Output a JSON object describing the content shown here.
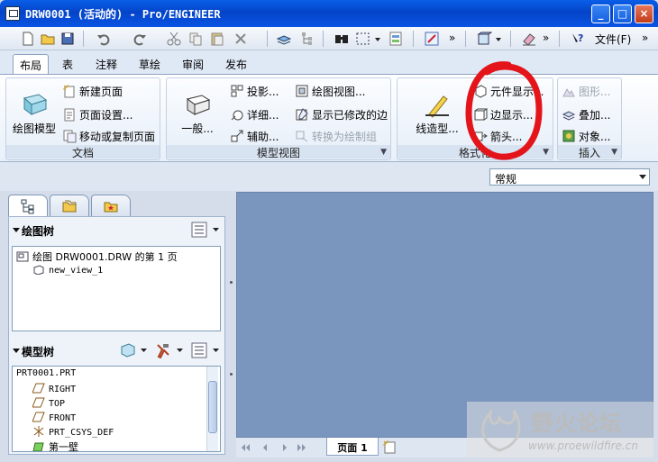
{
  "window": {
    "title": "DRW0001 (活动的) - Pro/ENGINEER",
    "minimize": "_",
    "maximize": "□",
    "close": "×"
  },
  "quickbar": {
    "file_menu": "文件(F)",
    "overflow": "»"
  },
  "tabs": [
    "布局",
    "表",
    "注释",
    "草绘",
    "审阅",
    "发布"
  ],
  "ribbon": {
    "document": {
      "label": "文档",
      "big_button": "绘图模型",
      "new_page": "新建页面",
      "page_setup": "页面设置...",
      "move_copy_page": "移动或复制页面"
    },
    "model_views": {
      "label": "模型视图",
      "big_button": "一般...",
      "projection": "投影...",
      "detail": "详细...",
      "auxiliary": "辅助...",
      "drawing_view": "绘图视图...",
      "show_modified_edges": "显示已修改的边",
      "convert_to_draft_group": "转换为绘制组"
    },
    "format": {
      "label": "格式化",
      "big_button": "线造型...",
      "component_display": "元件显示...",
      "edge_display": "边显示...",
      "arrow": "箭头..."
    },
    "insert": {
      "label": "插入",
      "graphics": "图形...",
      "overlay": "叠加...",
      "object": "对象..."
    }
  },
  "style_combo": {
    "value": "常规"
  },
  "navigator": {
    "drawing_tree": {
      "title": "绘图树",
      "root": "绘图 DRW0001.DRW 的第 1 页",
      "child": "new_view_1"
    },
    "model_tree": {
      "title": "模型树",
      "items": [
        "PRT0001.PRT",
        "RIGHT",
        "TOP",
        "FRONT",
        "PRT_CSYS_DEF",
        "第一壁"
      ]
    }
  },
  "pagebar": {
    "page_tab": "页面 1"
  },
  "watermark": {
    "name": "野火论坛",
    "url": "www.proewildfire.cn"
  },
  "colors": {
    "canvas": "#7b96be",
    "title_bar": "#0a54e4",
    "annotation": "#e4141b"
  }
}
